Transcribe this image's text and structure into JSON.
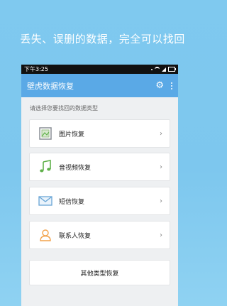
{
  "headline": "丢失、误删的数据，完全可以找回",
  "status_bar": {
    "time": "下午3:25"
  },
  "app_bar": {
    "title": "壁虎数据恢复"
  },
  "prompt": "请选择您要找回的数据类型",
  "options": [
    {
      "label": "图片恢复",
      "icon": "image-icon"
    },
    {
      "label": "音视频恢复",
      "icon": "music-note-icon"
    },
    {
      "label": "短信恢复",
      "icon": "envelope-icon"
    },
    {
      "label": "联系人恢复",
      "icon": "person-icon"
    }
  ],
  "other_option": {
    "label": "其他类型恢复"
  },
  "colors": {
    "background": "#7fc9ef",
    "app_bar": "#5aa9e6",
    "icon_green": "#5fb04a",
    "icon_blue": "#6aa6d6",
    "icon_orange": "#f2a24a"
  }
}
